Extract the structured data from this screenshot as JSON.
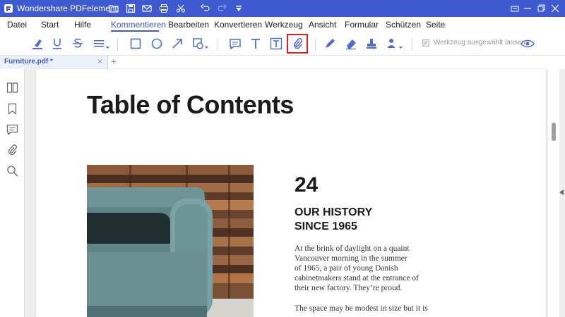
{
  "app": {
    "title": "Wondershare PDFelement",
    "accent_color": "#3e5ad0"
  },
  "quick_access": [
    "folder-icon",
    "save-icon",
    "mail-icon",
    "print-icon",
    "scissors-icon",
    "undo-icon",
    "redo-icon",
    "dropdown-icon"
  ],
  "window_controls": [
    "restore-icon",
    "minimize-icon",
    "maximize-icon",
    "close-icon"
  ],
  "menu": {
    "items": [
      "Datei",
      "Start",
      "Hilfe",
      "Kommentieren",
      "Bearbeiten",
      "Konvertieren",
      "Werkzeug",
      "Ansicht",
      "Formular",
      "Schützen",
      "Seite"
    ],
    "active": "Kommentieren"
  },
  "toolbar": {
    "tools": [
      "highlight-icon",
      "underline-icon",
      "strikethrough-icon",
      "lines-icon",
      "rectangle-icon",
      "circle-icon",
      "arrow-icon",
      "shapes-icon",
      "sticky-note-icon",
      "text-icon",
      "textbox-icon",
      "attachment-icon",
      "pencil-icon",
      "eraser-icon",
      "stamp-icon",
      "signature-icon",
      "eye-icon"
    ],
    "highlighted_tool": "attachment-icon",
    "keep_tool_label": "Werkzeug ausgewählt lassen",
    "keep_tool_checked": true
  },
  "tab": {
    "label": "Furniture.pdf *",
    "close": "×",
    "add": "+"
  },
  "sidebar": {
    "icons": [
      "thumbnails-icon",
      "bookmark-icon",
      "comment-icon",
      "attachment-icon",
      "search-icon"
    ]
  },
  "document": {
    "heading": "Table of Contents",
    "page_number": "24",
    "section_title_line1": "OUR HISTORY",
    "section_title_line2": "SINCE 1965",
    "paragraph1": [
      "At the brink of daylight on a quaint",
      "Vancouver morning in the summer",
      "of 1965, a pair of young Danish",
      "cabinetmakers stand at the entrance of",
      "their new factory. They’re proud."
    ],
    "paragraph2": [
      "The space may be modest in size but it is"
    ]
  }
}
